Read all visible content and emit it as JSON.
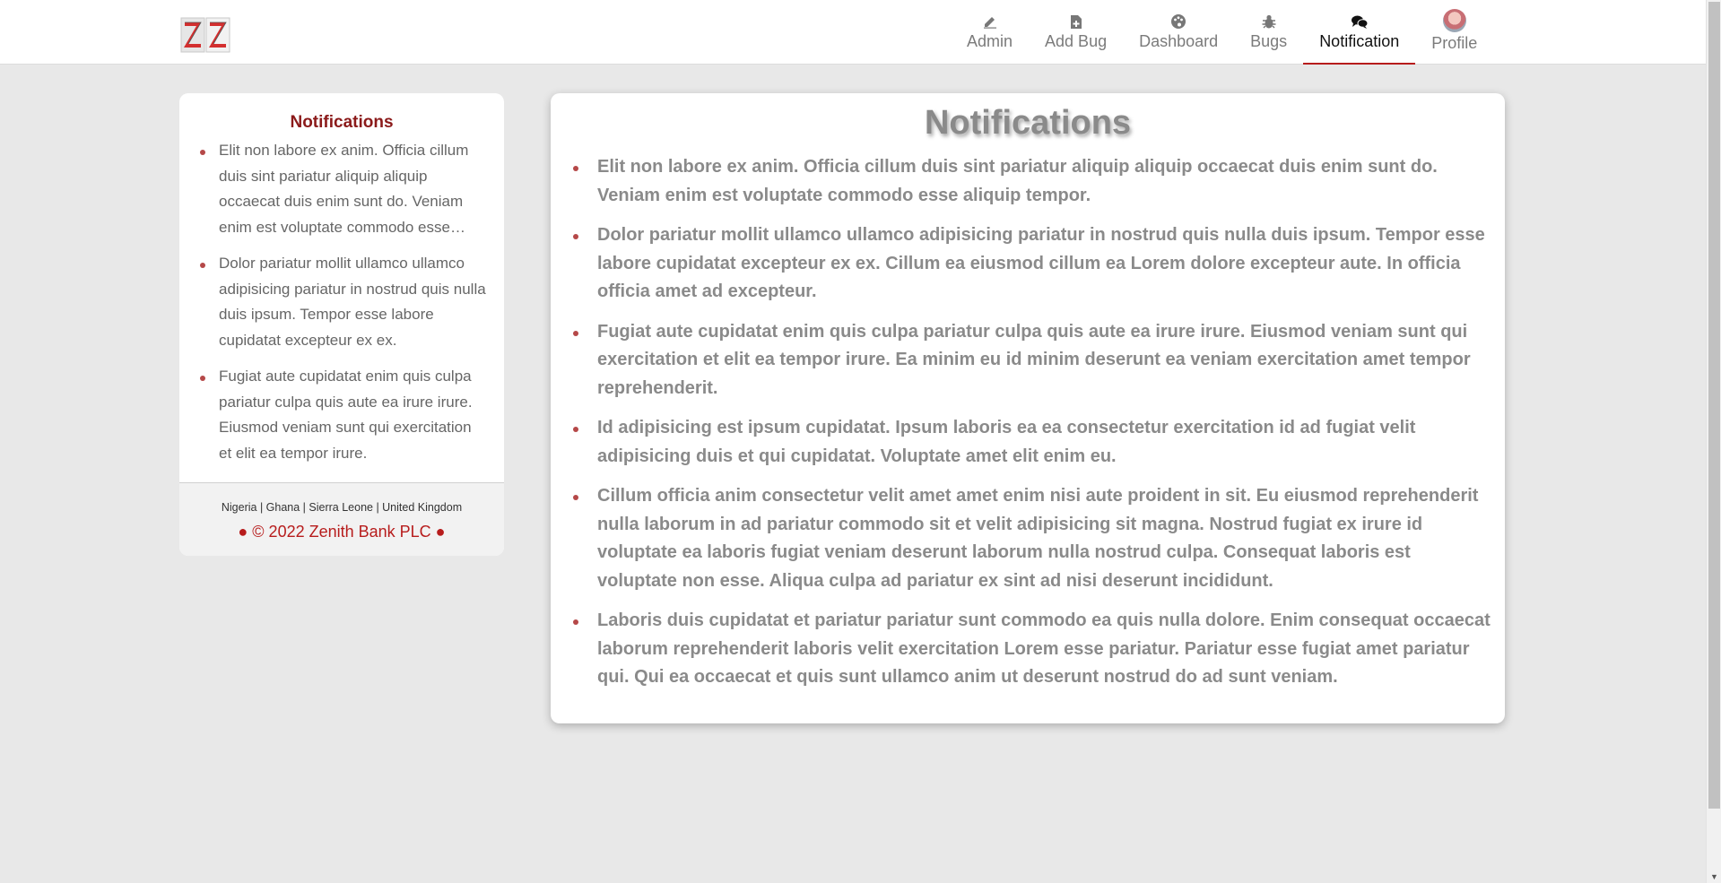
{
  "header": {
    "logo_alt": "ZENITH",
    "nav": [
      {
        "label": "Admin",
        "icon": "pencil-icon",
        "active": false
      },
      {
        "label": "Add Bug",
        "icon": "file-plus-icon",
        "active": false
      },
      {
        "label": "Dashboard",
        "icon": "palette-icon",
        "active": false
      },
      {
        "label": "Bugs",
        "icon": "bug-icon",
        "active": false
      },
      {
        "label": "Notification",
        "icon": "chat-bubbles-icon",
        "active": true
      },
      {
        "label": "Profile",
        "icon": "avatar",
        "active": false
      }
    ]
  },
  "sidebar": {
    "title": "Notifications",
    "items": [
      "Elit non labore ex anim. Officia cillum duis sint pariatur aliquip aliquip occaecat duis enim sunt do. Veniam enim est voluptate commodo esse aliquip tempor.",
      "Dolor pariatur mollit ullamco ullamco adipisicing pariatur in nostrud quis nulla duis ipsum. Tempor esse labore cupidatat excepteur ex ex.",
      "Fugiat aute cupidatat enim quis culpa pariatur culpa quis aute ea irure irure. Eiusmod veniam sunt qui exercitation et elit ea tempor irure."
    ],
    "footer": {
      "countries": "Nigeria | Ghana | Sierra Leone | United Kingdom",
      "copyright": "● © 2022 Zenith Bank PLC ●"
    }
  },
  "main": {
    "title": "Notifications",
    "items": [
      "Elit non labore ex anim. Officia cillum duis sint pariatur aliquip aliquip occaecat duis enim sunt do. Veniam enim est voluptate commodo esse aliquip tempor.",
      "Dolor pariatur mollit ullamco ullamco adipisicing pariatur in nostrud quis nulla duis ipsum. Tempor esse labore cupidatat excepteur ex ex. Cillum ea eiusmod cillum ea Lorem dolore excepteur aute. In officia officia amet ad excepteur.",
      "Fugiat aute cupidatat enim quis culpa pariatur culpa quis aute ea irure irure. Eiusmod veniam sunt qui exercitation et elit ea tempor irure. Ea minim eu id minim deserunt ea veniam exercitation amet tempor reprehenderit.",
      "Id adipisicing est ipsum cupidatat. Ipsum laboris ea ea consectetur exercitation id ad fugiat velit adipisicing duis et qui cupidatat. Voluptate amet elit enim eu.",
      "Cillum officia anim consectetur velit amet amet enim nisi aute proident in sit. Eu eiusmod reprehenderit nulla laborum in ad pariatur commodo sit et velit adipisicing sit magna. Nostrud fugiat ex irure id voluptate ea laboris fugiat veniam deserunt laborum nulla nostrud culpa. Consequat laboris est voluptate non esse. Aliqua culpa ad pariatur ex sint ad nisi deserunt incididunt.",
      "Laboris duis cupidatat et pariatur pariatur sunt commodo ea quis nulla dolore. Enim consequat occaecat laborum reprehenderit laboris velit exercitation Lorem esse pariatur. Pariatur esse fugiat amet pariatur qui. Qui ea occaecat et quis sunt ullamco anim ut deserunt nostrud do ad sunt veniam."
    ]
  },
  "colors": {
    "brand_red": "#b71c1c",
    "title_red": "#8b1a1a",
    "page_bg": "#e8e8e8",
    "text_grey": "#8a8a8a"
  }
}
